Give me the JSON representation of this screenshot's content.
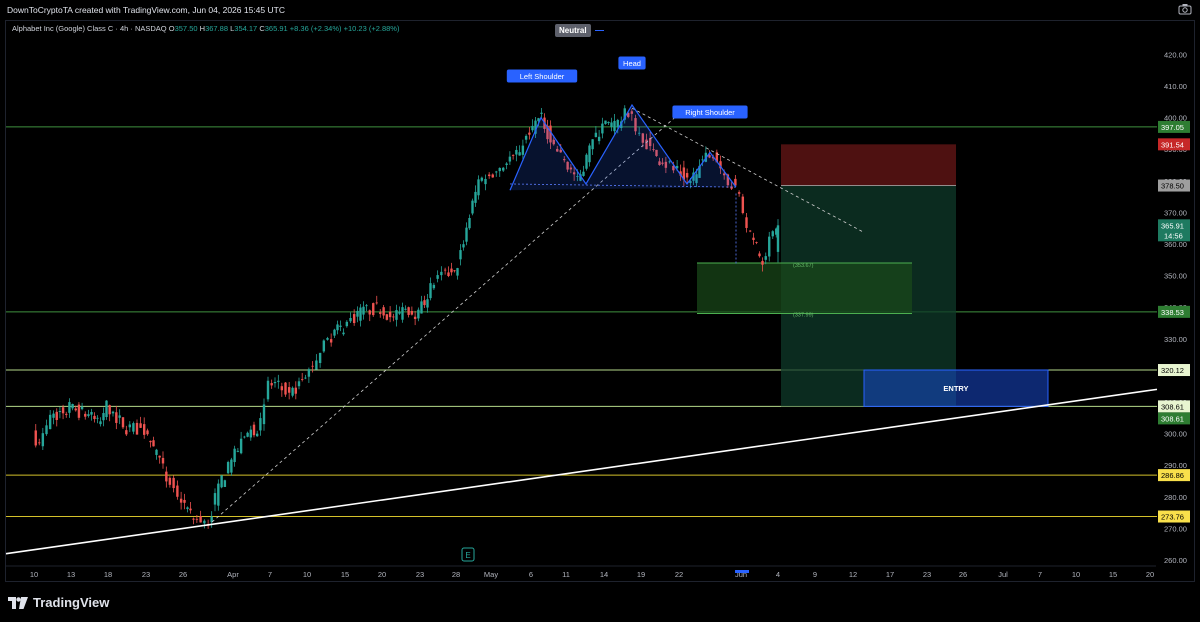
{
  "header": {
    "credit": "DownToCryptoTA created with TradingView.com, Jun 04, 2026 15:45 UTC"
  },
  "legend": {
    "symbol": "Alphabet Inc (Google) Class C · 4h · NASDAQ",
    "open_label": "O",
    "open": "357.50",
    "high_label": "H",
    "high": "367.88",
    "low_label": "L",
    "low": "354.17",
    "close_label": "C",
    "close": "365.91",
    "change": "+8.36 (+2.34%)",
    "change2": "+10.23 (+2.88%)"
  },
  "indicator": {
    "label": "Neutral",
    "color": "#2962ff"
  },
  "brand": {
    "name": "TradingView"
  },
  "colors": {
    "background": "#000000",
    "up": "#26a69a",
    "down": "#ef5350",
    "level_green": "#4caf50",
    "level_yellow": "#ffeb3b",
    "level_white": "#c8c8c8",
    "pattern_blue": "#2962ff",
    "entry_blue": "#1848cc",
    "stop_red": "#5c1414",
    "target_green": "#0f3a2a"
  },
  "chart_data": {
    "type": "candlestick",
    "symbol": "Alphabet Inc (Google) Class C",
    "interval": "4h",
    "exchange": "NASDAQ",
    "ylim": [
      254,
      425
    ],
    "y_ticks": [
      260,
      270,
      280,
      290,
      300,
      310,
      320,
      330,
      340,
      350,
      360,
      370,
      380,
      390,
      400,
      410,
      420
    ],
    "x_ticks": [
      "10",
      "13",
      "18",
      "23",
      "26",
      "Apr",
      "7",
      "10",
      "15",
      "20",
      "23",
      "28",
      "May",
      "6",
      "11",
      "14",
      "19",
      "22",
      "Jun",
      "4",
      "9",
      "12",
      "17",
      "23",
      "26",
      "Jul",
      "7",
      "10",
      "15",
      "20"
    ],
    "ohlc_path": [
      {
        "d": "Mar 10",
        "p": 301
      },
      {
        "d": "Mar 11",
        "p": 296
      },
      {
        "d": "Mar 12",
        "p": 305
      },
      {
        "d": "Mar 13",
        "p": 308
      },
      {
        "d": "Mar 16",
        "p": 306
      },
      {
        "d": "Mar 17",
        "p": 303
      },
      {
        "d": "Mar 18",
        "p": 309
      },
      {
        "d": "Mar 19",
        "p": 305
      },
      {
        "d": "Mar 20",
        "p": 302
      },
      {
        "d": "Mar 23",
        "p": 301
      },
      {
        "d": "Mar 24",
        "p": 293
      },
      {
        "d": "Mar 25",
        "p": 286
      },
      {
        "d": "Mar 26",
        "p": 279
      },
      {
        "d": "Mar 27",
        "p": 273
      },
      {
        "d": "Mar 30",
        "p": 272
      },
      {
        "d": "Mar 31",
        "p": 283
      },
      {
        "d": "Apr 1",
        "p": 291
      },
      {
        "d": "Apr 2",
        "p": 299
      },
      {
        "d": "Apr 6",
        "p": 303
      },
      {
        "d": "Apr 7",
        "p": 316
      },
      {
        "d": "Apr 8",
        "p": 315
      },
      {
        "d": "Apr 9",
        "p": 312
      },
      {
        "d": "Apr 10",
        "p": 318
      },
      {
        "d": "Apr 13",
        "p": 326
      },
      {
        "d": "Apr 14",
        "p": 331
      },
      {
        "d": "Apr 15",
        "p": 334
      },
      {
        "d": "Apr 16",
        "p": 337
      },
      {
        "d": "Apr 17",
        "p": 339
      },
      {
        "d": "Apr 20",
        "p": 340
      },
      {
        "d": "Apr 21",
        "p": 336
      },
      {
        "d": "Apr 22",
        "p": 340
      },
      {
        "d": "Apr 23",
        "p": 338
      },
      {
        "d": "Apr 24",
        "p": 346
      },
      {
        "d": "Apr 27",
        "p": 351
      },
      {
        "d": "Apr 28",
        "p": 350
      },
      {
        "d": "Apr 29",
        "p": 365
      },
      {
        "d": "Apr 30",
        "p": 380
      },
      {
        "d": "May 1",
        "p": 382
      },
      {
        "d": "May 4",
        "p": 385
      },
      {
        "d": "May 5",
        "p": 388
      },
      {
        "d": "May 6",
        "p": 396
      },
      {
        "d": "May 7",
        "p": 400
      },
      {
        "d": "May 8",
        "p": 393
      },
      {
        "d": "May 11",
        "p": 386
      },
      {
        "d": "May 12",
        "p": 380
      },
      {
        "d": "May 13",
        "p": 390
      },
      {
        "d": "May 14",
        "p": 398
      },
      {
        "d": "May 15",
        "p": 397
      },
      {
        "d": "May 18",
        "p": 402
      },
      {
        "d": "May 19",
        "p": 395
      },
      {
        "d": "May 20",
        "p": 390
      },
      {
        "d": "May 21",
        "p": 386
      },
      {
        "d": "May 22",
        "p": 383
      },
      {
        "d": "May 26",
        "p": 380
      },
      {
        "d": "May 27",
        "p": 386
      },
      {
        "d": "May 28",
        "p": 389
      },
      {
        "d": "May 29",
        "p": 382
      },
      {
        "d": "Jun 1",
        "p": 375
      },
      {
        "d": "Jun 2",
        "p": 362
      },
      {
        "d": "Jun 3",
        "p": 355
      },
      {
        "d": "Jun 4",
        "p": 365.91
      }
    ],
    "levels": [
      {
        "price": 397.05,
        "label": "397.05",
        "kind": "support-resistance"
      },
      {
        "price": 391.54,
        "label": "391.54",
        "kind": "stop"
      },
      {
        "price": 378.5,
        "label": "378.50",
        "kind": "entry-short"
      },
      {
        "price": 365.91,
        "label": "365.91",
        "kind": "last-price",
        "sub": "14:56"
      },
      {
        "price": 338.53,
        "label": "338.53",
        "kind": "support-resistance"
      },
      {
        "price": 320.12,
        "label": "320.12",
        "kind": "support-resistance"
      },
      {
        "price": 308.61,
        "label": "308.61",
        "kind": "support-resistance"
      },
      {
        "price": 308.61,
        "label": "308.61",
        "kind": "target"
      },
      {
        "price": 286.86,
        "label": "286.86",
        "kind": "yellow"
      },
      {
        "price": 273.76,
        "label": "273.76",
        "kind": "yellow"
      }
    ],
    "pattern": {
      "name": "Head and Shoulders",
      "labels": [
        "Left Shoulder",
        "Head",
        "Right Shoulder"
      ],
      "neckline_price": 378,
      "projection_labels": [
        "(353.67)",
        "(337.99)"
      ]
    },
    "zones": [
      {
        "name": "stop",
        "from": 378.5,
        "to": 391.54
      },
      {
        "name": "target",
        "from": 308.61,
        "to": 378.5
      },
      {
        "name": "projection",
        "from": 338,
        "to": 354
      },
      {
        "name": "entry",
        "from": 308.61,
        "to": 320.12,
        "label": "ENTRY"
      }
    ],
    "trendline": {
      "from": {
        "date": "Mar 4",
        "price": 262
      },
      "to": {
        "date": "Jul 23",
        "price": 314
      }
    },
    "event_marker": "E"
  }
}
